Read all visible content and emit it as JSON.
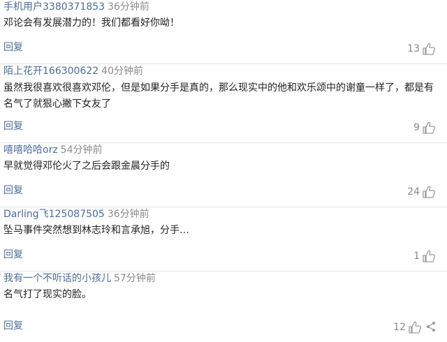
{
  "comments": [
    {
      "user": "手机用户3380371853",
      "time": "36分钟前",
      "text": "邓论会有发展潜力的！我们都看好你呦！",
      "reply_label": "回复",
      "likes": "13"
    },
    {
      "user": "陌上花开166300622",
      "time": "40分钟前",
      "text": "虽然我很喜欢很喜欢邓伦，但是如果分手是真的，那么现实中的他和欢乐颂中的谢童一样了，都是有名气了就狠心撇下女友了",
      "reply_label": "回复",
      "likes": "9"
    },
    {
      "user": "嘻嘻哈哈orz",
      "time": "54分钟前",
      "text": "早就觉得邓伦火了之后会跟金晨分手的",
      "reply_label": "回复",
      "likes": "24"
    },
    {
      "user": "Darling飞125087505",
      "time": "36分钟前",
      "text": "坠马事件突然想到林志玲和言承旭，分手…",
      "reply_label": "回复",
      "likes": "1"
    },
    {
      "user": "我有一个不听话的小孩儿",
      "time": "57分钟前",
      "text": "名气打了现实的脸。",
      "reply_label": "回复",
      "likes": "12"
    }
  ],
  "icons": {
    "like": "thumbs-up-icon",
    "share": "share-icon"
  },
  "colors": {
    "username": "#4a6d9c",
    "meta": "#8a8a8a",
    "text": "#222222",
    "divider": "#e6e6e6"
  }
}
